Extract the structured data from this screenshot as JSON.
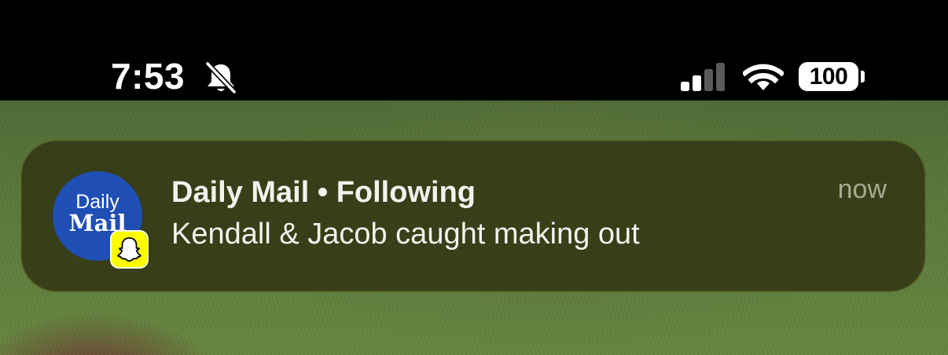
{
  "status_bar": {
    "time": "7:53",
    "silent_icon": "bell-slash-icon",
    "signal_icon": "cellular-signal-icon",
    "signal_bars_active": 2,
    "signal_bars_total": 4,
    "wifi_icon": "wifi-icon",
    "battery_level": "100"
  },
  "notification": {
    "app_icon": "daily-mail-icon",
    "app_icon_text_top": "Daily",
    "app_icon_text_bottom": "Mail",
    "badge_icon": "snapchat-ghost-icon",
    "title": "Daily Mail • Following",
    "message": "Kendall & Jacob caught making out",
    "time": "now"
  },
  "colors": {
    "status_bar_bg": "#000000",
    "notification_bg": "#343a16",
    "app_icon_bg": "#1f4fb5",
    "badge_bg": "#fffc00"
  }
}
